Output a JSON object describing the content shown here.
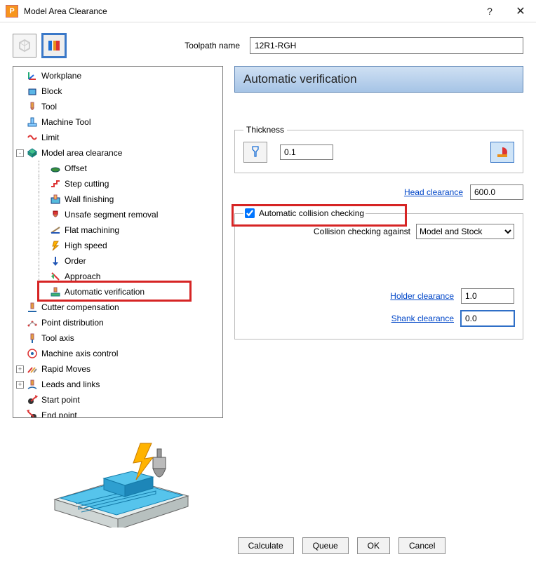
{
  "window": {
    "title": "Model Area Clearance",
    "help_icon": "?",
    "close_icon": "✕"
  },
  "toolpath": {
    "label": "Toolpath name",
    "value": "12R1-RGH"
  },
  "tree": [
    {
      "label": "Workplane",
      "icon": "workplane-icon",
      "exp": null
    },
    {
      "label": "Block",
      "icon": "block-icon",
      "exp": null
    },
    {
      "label": "Tool",
      "icon": "tool-icon",
      "exp": null
    },
    {
      "label": "Machine Tool",
      "icon": "machine-tool-icon",
      "exp": null
    },
    {
      "label": "Limit",
      "icon": "limit-icon",
      "exp": null
    },
    {
      "label": "Model area clearance",
      "icon": "clearance-icon",
      "exp": "-",
      "children": [
        {
          "label": "Offset",
          "icon": "offset-icon"
        },
        {
          "label": "Step cutting",
          "icon": "step-icon"
        },
        {
          "label": "Wall finishing",
          "icon": "wall-icon"
        },
        {
          "label": "Unsafe segment removal",
          "icon": "unsafe-icon"
        },
        {
          "label": "Flat machining",
          "icon": "flat-icon"
        },
        {
          "label": "High speed",
          "icon": "hispeed-icon"
        },
        {
          "label": "Order",
          "icon": "order-icon"
        },
        {
          "label": "Approach",
          "icon": "approach-icon"
        },
        {
          "label": "Automatic verification",
          "icon": "autoverify-icon",
          "highlight": true
        }
      ]
    },
    {
      "label": "Cutter compensation",
      "icon": "cuttercomp-icon",
      "exp": null
    },
    {
      "label": "Point distribution",
      "icon": "pointdist-icon",
      "exp": null
    },
    {
      "label": "Tool axis",
      "icon": "toolaxis-icon",
      "exp": null
    },
    {
      "label": "Machine axis control",
      "icon": "machineaxis-icon",
      "exp": null
    },
    {
      "label": "Rapid Moves",
      "icon": "rapid-icon",
      "exp": "+"
    },
    {
      "label": "Leads and links",
      "icon": "leads-icon",
      "exp": "+"
    },
    {
      "label": "Start point",
      "icon": "startpt-icon",
      "exp": null
    },
    {
      "label": "End point",
      "icon": "endpt-icon",
      "exp": null
    }
  ],
  "panel": {
    "header": "Automatic verification",
    "thickness": {
      "legend": "Thickness",
      "value": "0.1"
    },
    "head": {
      "label": "Head clearance",
      "value": "600.0"
    },
    "auto_check": {
      "label": "Automatic collision checking",
      "checked": true,
      "against_label": "Collision checking against",
      "against_value": "Model and Stock"
    },
    "holder": {
      "label": "Holder clearance",
      "value": "1.0"
    },
    "shank": {
      "label": "Shank clearance",
      "value": "0.0"
    }
  },
  "buttons": {
    "calculate": "Calculate",
    "queue": "Queue",
    "ok": "OK",
    "cancel": "Cancel"
  }
}
